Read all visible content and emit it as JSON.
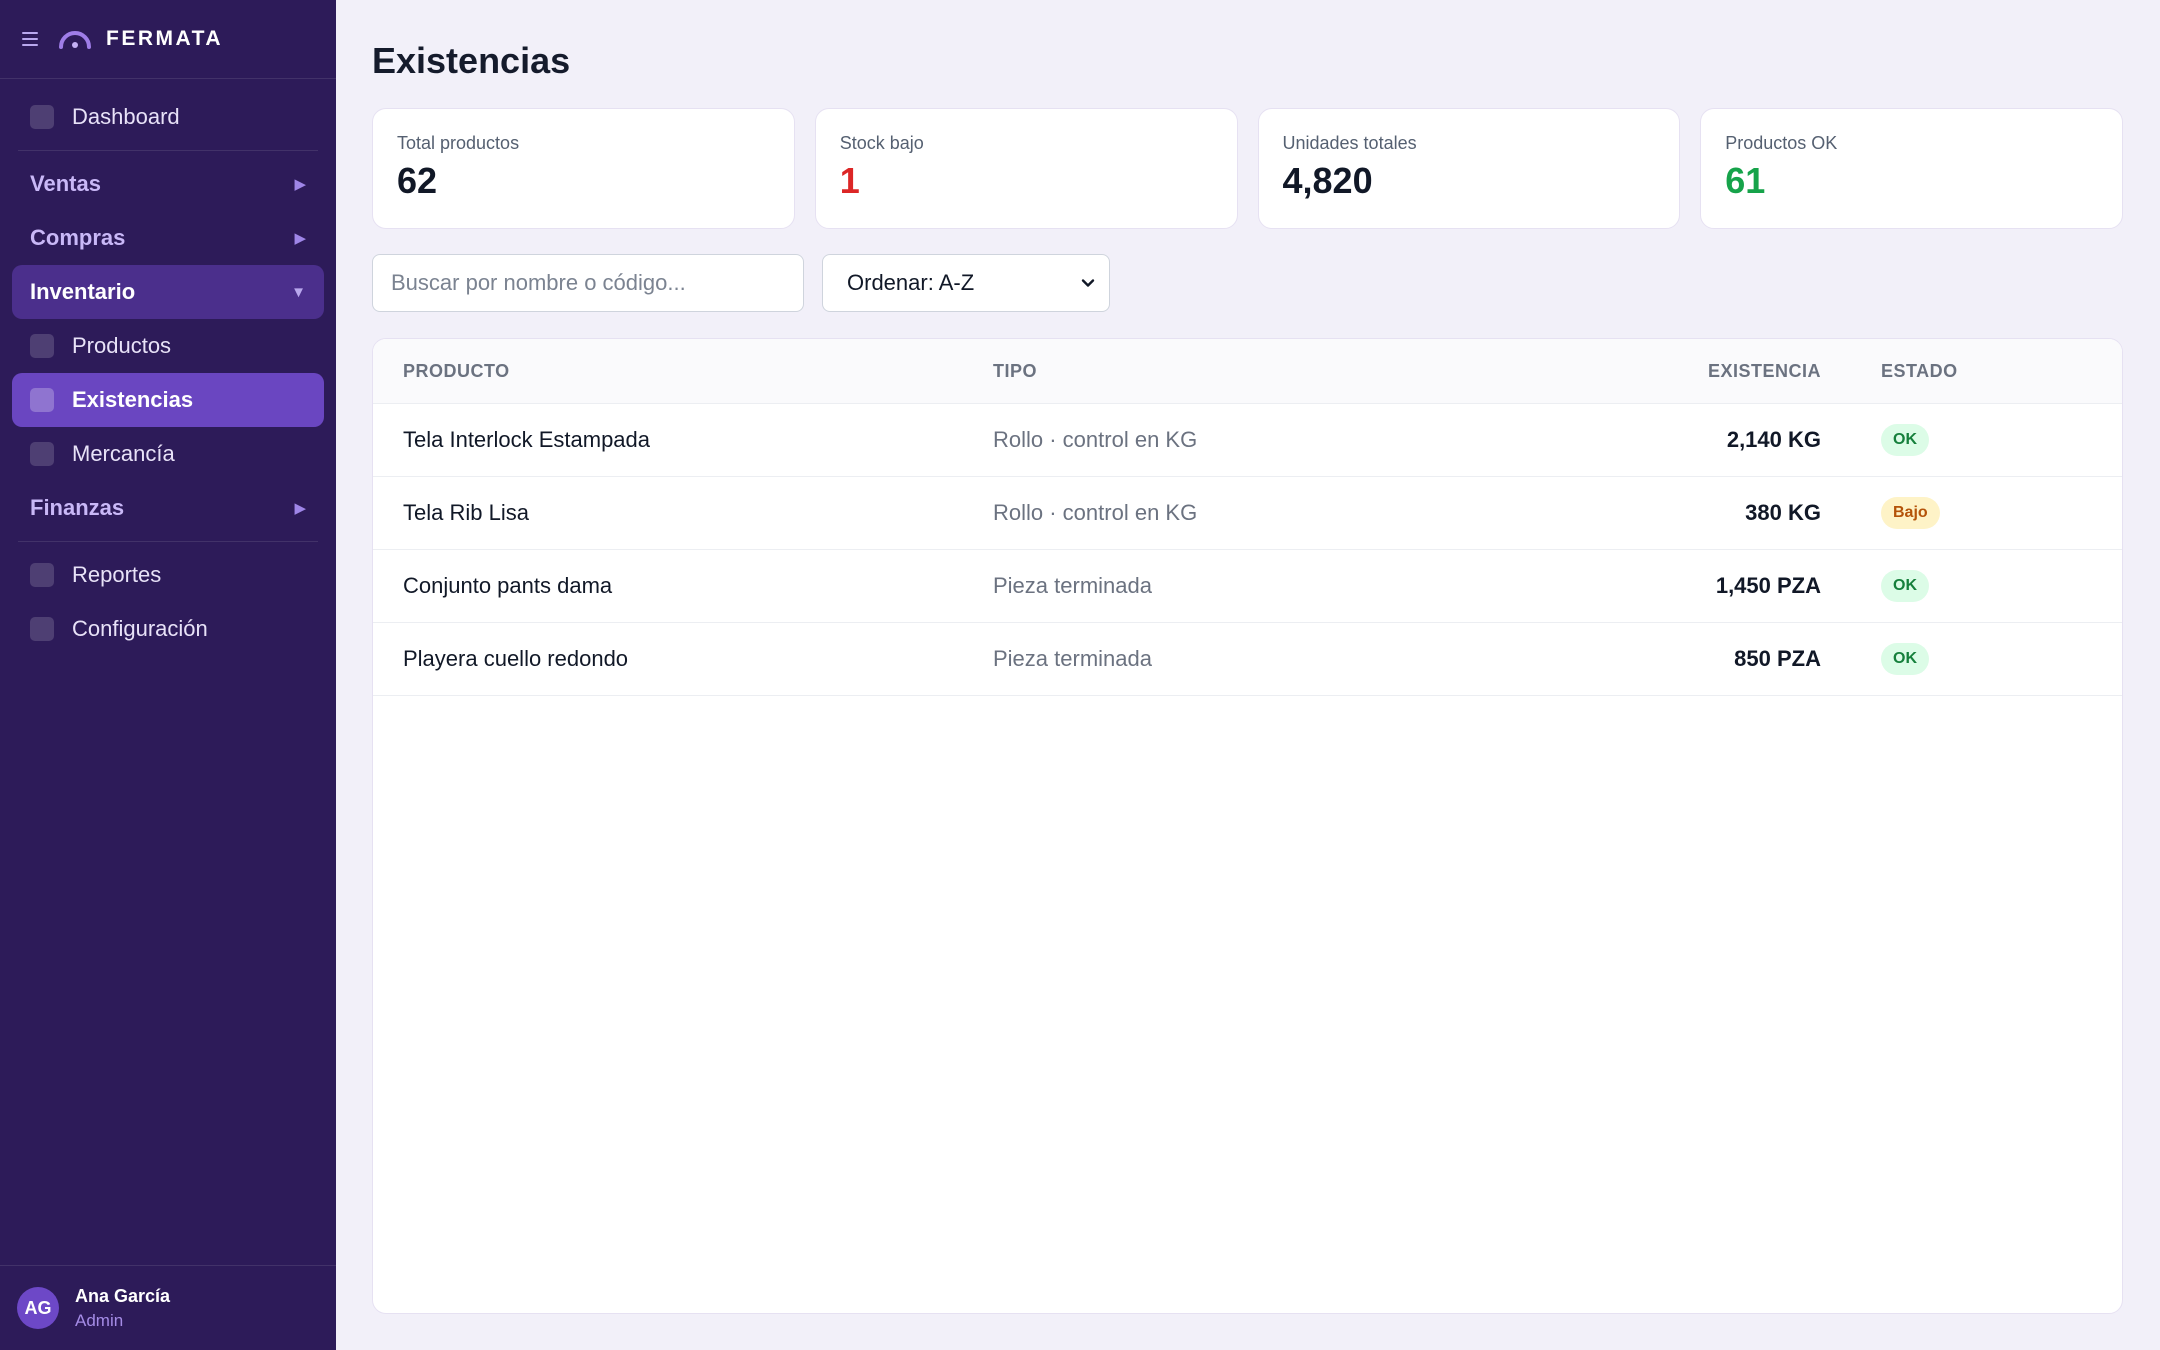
{
  "brand": "FERMATA",
  "colors": {
    "sidebar_bg": "#2d1b59",
    "accent": "#6a46c1",
    "danger": "#dc2626",
    "success": "#16a34a"
  },
  "sidebar": {
    "dashboard": "Dashboard",
    "ventas": "Ventas",
    "compras": "Compras",
    "inventario": "Inventario",
    "productos": "Productos",
    "existencias": "Existencias",
    "mercancia": "Mercancía",
    "finanzas": "Finanzas",
    "reportes": "Reportes",
    "configuracion": "Configuración"
  },
  "user": {
    "initials": "AG",
    "name": "Ana García",
    "role": "Admin"
  },
  "page": {
    "title": "Existencias"
  },
  "stats": [
    {
      "label": "Total productos",
      "value": "62"
    },
    {
      "label": "Stock bajo",
      "value": "1",
      "color": "#dc2626"
    },
    {
      "label": "Unidades totales",
      "value": "4,820"
    },
    {
      "label": "Productos OK",
      "value": "61",
      "color": "#16a34a"
    }
  ],
  "search": {
    "placeholder": "Buscar por nombre o código..."
  },
  "sort": {
    "selected": "Ordenar: A-Z"
  },
  "table": {
    "headers": {
      "producto": "PRODUCTO",
      "tipo": "TIPO",
      "existencia": "EXISTENCIA",
      "estado": "ESTADO"
    },
    "rows": [
      {
        "producto": "Tela Interlock Estampada",
        "tipo": "Rollo · control en KG",
        "existencia": "2,140 KG",
        "estado": "OK"
      },
      {
        "producto": "Tela Rib Lisa",
        "tipo": "Rollo · control en KG",
        "existencia": "380 KG",
        "estado": "Bajo"
      },
      {
        "producto": "Conjunto pants dama",
        "tipo": "Pieza terminada",
        "existencia": "1,450 PZA",
        "estado": "OK"
      },
      {
        "producto": "Playera cuello redondo",
        "tipo": "Pieza terminada",
        "existencia": "850 PZA",
        "estado": "OK"
      }
    ]
  }
}
